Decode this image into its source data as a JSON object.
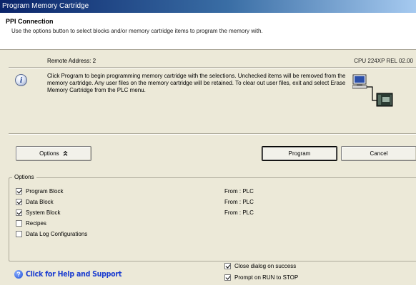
{
  "window": {
    "title": "Program Memory Cartridge"
  },
  "header": {
    "title": "PPI Connection",
    "subtitle": "Use the options button to select blocks and/or memory cartridge items to program the memory with."
  },
  "connection": {
    "remote_address": "Remote Address: 2",
    "cpu": "CPU 224XP REL 02.00"
  },
  "info": {
    "icon": "info-icon",
    "text": "Click Program to begin programming memory cartridge with the selections. Unchecked items will be removed from the memory cartridge. Any user files on the memory cartridge will be retained. To clear out user files, exit and select Erase Memory Cartridge from the PLC menu."
  },
  "buttons": {
    "options": "Options",
    "options_icon": "double-chevron-up-icon",
    "program": "Program",
    "cancel": "Cancel"
  },
  "options_group": {
    "legend": "Options",
    "items": [
      {
        "label": "Program Block",
        "checked": true,
        "source": "From : PLC"
      },
      {
        "label": "Data Block",
        "checked": true,
        "source": "From : PLC"
      },
      {
        "label": "System Block",
        "checked": true,
        "source": "From : PLC"
      },
      {
        "label": "Recipes",
        "checked": false,
        "source": ""
      },
      {
        "label": "Data Log Configurations",
        "checked": false,
        "source": ""
      }
    ]
  },
  "footer": {
    "help_link": "Click for Help and Support",
    "close_on_success": {
      "label": "Close dialog on success",
      "checked": true
    },
    "prompt_run_to_stop": {
      "label": "Prompt on RUN to STOP",
      "checked": true
    }
  },
  "colors": {
    "dialog_bg": "#ece9d8",
    "titlebar_start": "#0a246a",
    "titlebar_end": "#a6caf0",
    "help_link": "#1a3cd0"
  }
}
